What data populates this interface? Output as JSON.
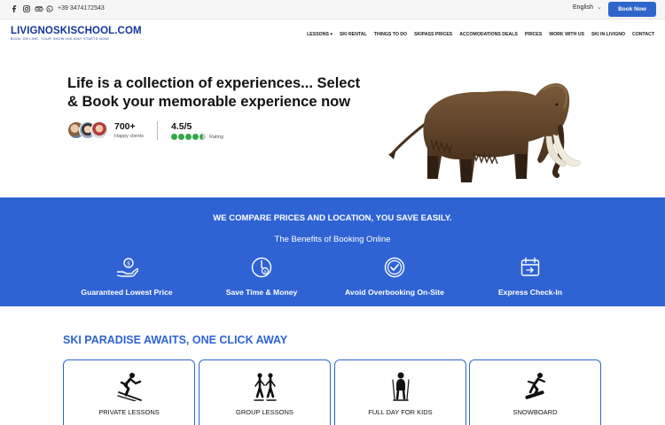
{
  "topbar": {
    "phone": "+39 3474172543",
    "language": "English",
    "book_button": "Book Now"
  },
  "brand": {
    "name": "LIVIGNOSKISCHOOL.COM",
    "tagline": "BOOK ON LINE, YOUR SNOW HOLIDAY STARTS NOW!"
  },
  "nav": {
    "items": [
      "LESSONS ▾",
      "SKI RENTAL",
      "THINGS TO DO",
      "SKIPASS PRICES",
      "ACCOMODATIONS DEALS",
      "PRICES",
      "WORK WITH US",
      "SKI IN LIVIGNO",
      "CONTACT"
    ]
  },
  "hero": {
    "title": "Life is a collection of experiences... Select & Book your memorable experience now",
    "clients_count": "700+",
    "clients_label": "Happy clients",
    "rating_value": "4.5/5",
    "rating_label": "Rating",
    "rating_stars": 4.5
  },
  "benefits": {
    "title": "WE COMPARE PRICES AND LOCATION, YOU SAVE EASILY.",
    "subtitle": "The Benefits of Booking Online",
    "items": [
      {
        "label": "Guaranteed Lowest Price",
        "icon": "hand-coin-icon"
      },
      {
        "label": "Save Time & Money",
        "icon": "clock-coin-icon"
      },
      {
        "label": "Avoid Overbooking On-Site",
        "icon": "check-circle-icon"
      },
      {
        "label": "Express Check-In",
        "icon": "calendar-checkin-icon"
      }
    ]
  },
  "activities": {
    "title": "SKI PARADISE AWAITS, ONE CLICK AWAY",
    "cards": [
      {
        "label": "PRIVATE LESSONS",
        "icon": "skier-icon"
      },
      {
        "label": "GROUP LESSONS",
        "icon": "skiers-group-icon"
      },
      {
        "label": "FULL DAY FOR KIDS",
        "icon": "kid-skier-icon"
      },
      {
        "label": "SNOWBOARD",
        "icon": "snowboarder-icon"
      }
    ]
  },
  "colors": {
    "brand_blue": "#2f63d4",
    "logo_navy": "#15359a",
    "rating_green": "#2fa845"
  }
}
